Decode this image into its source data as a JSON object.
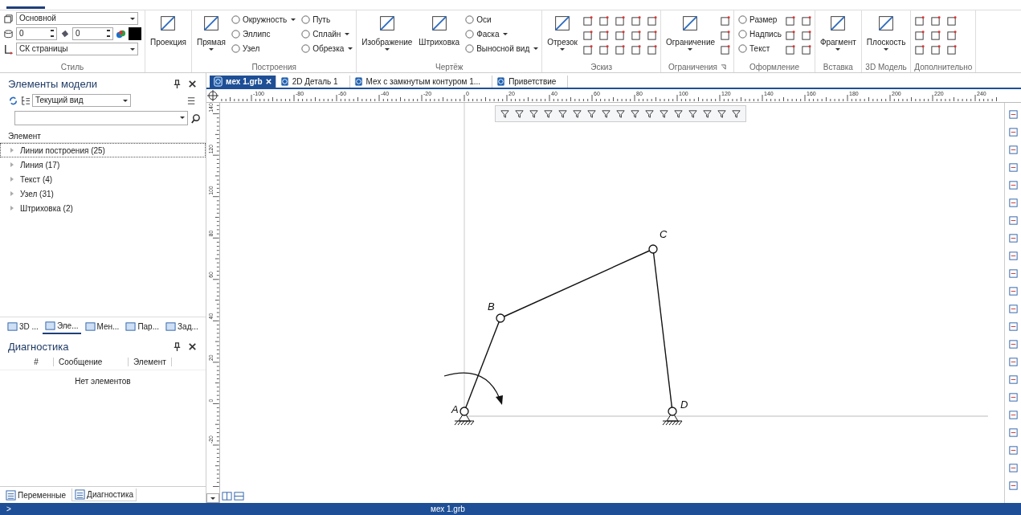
{
  "ribbon": {
    "groups": [
      {
        "kind": "style",
        "label": "Стиль",
        "layer": "Основной",
        "spin_a": "0",
        "spin_b": "0",
        "system": "СК страницы"
      },
      {
        "kind": "tools",
        "large": [
          {
            "label": "Проекция",
            "dropdown": false
          }
        ]
      },
      {
        "kind": "tools",
        "label": "Построения",
        "large": [
          {
            "label": "Прямая",
            "dropdown": true
          }
        ],
        "small": [
          {
            "label": "Окружность",
            "dropdown": true
          },
          {
            "label": "Эллипс",
            "dropdown": false
          },
          {
            "label": "Узел",
            "dropdown": false
          },
          {
            "label": "Путь",
            "dropdown": false
          },
          {
            "label": "Сплайн",
            "dropdown": true
          },
          {
            "label": "Обрезка",
            "dropdown": true
          }
        ]
      },
      {
        "kind": "tools",
        "label": "Чертёж",
        "large": [
          {
            "label": "Изображение",
            "dropdown": true
          },
          {
            "label": "Штриховка",
            "dropdown": false
          }
        ],
        "small": [
          {
            "label": "Оси",
            "dropdown": false
          },
          {
            "label": "Фаска",
            "dropdown": true
          },
          {
            "label": "Выносной вид",
            "dropdown": true
          }
        ]
      },
      {
        "kind": "sketch",
        "label": "Эскиз",
        "large": [
          {
            "label": "Отрезок",
            "dropdown": true
          }
        ]
      },
      {
        "kind": "constraints",
        "label": "Ограничения",
        "launcher": true,
        "large": [
          {
            "label": "Ограничение",
            "dropdown": true
          }
        ]
      },
      {
        "kind": "design",
        "label": "Оформление",
        "small": [
          {
            "label": "Размер",
            "dropdown": false
          },
          {
            "label": "Надпись",
            "dropdown": false
          },
          {
            "label": "Текст",
            "dropdown": false
          }
        ]
      },
      {
        "kind": "tools",
        "label": "Вставка",
        "large": [
          {
            "label": "Фрагмент",
            "dropdown": true
          }
        ]
      },
      {
        "kind": "tools",
        "label": "3D Модель",
        "large": [
          {
            "label": "Плоскость",
            "dropdown": true
          }
        ]
      },
      {
        "kind": "extra",
        "label": "Дополнительно"
      }
    ]
  },
  "model_panel": {
    "title": "Элементы модели",
    "view": "Текущий вид",
    "column": "Элемент",
    "items": [
      {
        "label": "Линии построения (25)",
        "selected": true
      },
      {
        "label": "Линия (17)",
        "selected": false
      },
      {
        "label": "Текст (4)",
        "selected": false
      },
      {
        "label": "Узел (31)",
        "selected": false
      },
      {
        "label": "Штриховка (2)",
        "selected": false
      }
    ],
    "tabs": [
      {
        "label": "3D ...",
        "selected": false
      },
      {
        "label": "Эле...",
        "selected": true
      },
      {
        "label": "Мен...",
        "selected": false
      },
      {
        "label": "Пар...",
        "selected": false
      },
      {
        "label": "Зад...",
        "selected": false
      }
    ]
  },
  "diagnostics": {
    "title": "Диагностика",
    "columns": [
      "#",
      "Сообщение",
      "Элемент"
    ],
    "empty": "Нет элементов",
    "tabs": [
      {
        "label": "Переменные",
        "selected": false
      },
      {
        "label": "Диагностика",
        "selected": true
      }
    ]
  },
  "documents": [
    {
      "label": "мех 1.grb",
      "selected": true
    },
    {
      "label": "2D Деталь 1",
      "selected": false
    },
    {
      "label": "Мех с замкнутым контуром 1...",
      "selected": false
    },
    {
      "label": "Приветствие",
      "selected": false
    }
  ],
  "ruler": {
    "horizontal": [
      "-100",
      "-80",
      "-60",
      "-40",
      "-20",
      "0",
      "20",
      "40",
      "60",
      "80",
      "100",
      "120",
      "140",
      "160",
      "180",
      "200",
      "220",
      "240"
    ],
    "vertical": [
      "140",
      "120",
      "100",
      "80",
      "60",
      "40",
      "20",
      "0",
      "-20"
    ]
  },
  "mechanism": {
    "points": [
      {
        "label": "A"
      },
      {
        "label": "B"
      },
      {
        "label": "C"
      },
      {
        "label": "D"
      }
    ]
  },
  "status_bar": {
    "prompt": ">",
    "document": "мех 1.grb"
  }
}
